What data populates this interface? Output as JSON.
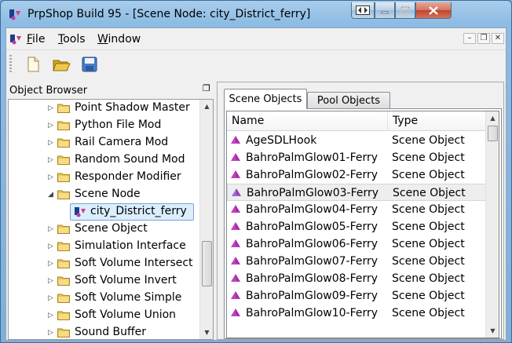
{
  "window": {
    "title": "PrpShop Build 95 - [Scene Node: city_District_ferry]",
    "restore_icon": "restore-mirror-icon",
    "min_icon": "minimize-icon",
    "max_icon": "maximize-icon",
    "close_icon": "close-icon"
  },
  "menubar": {
    "items": [
      "File",
      "Tools",
      "Window"
    ],
    "mdi_buttons": [
      "–",
      "❐",
      "✕"
    ]
  },
  "toolbar": {
    "buttons": [
      "new-file-icon",
      "open-folder-icon",
      "save-icon"
    ]
  },
  "object_browser": {
    "title": "Object Browser",
    "float_icon": "❐",
    "items": [
      {
        "label": "Point Shadow Master",
        "expanded": false
      },
      {
        "label": "Python File Mod",
        "expanded": false
      },
      {
        "label": "Rail Camera Mod",
        "expanded": false
      },
      {
        "label": "Random Sound Mod",
        "expanded": false
      },
      {
        "label": "Responder Modifier",
        "expanded": false
      },
      {
        "label": "Scene Node",
        "expanded": true
      },
      {
        "label": "city_District_ferry",
        "child": true,
        "selected": true
      },
      {
        "label": "Scene Object",
        "expanded": false
      },
      {
        "label": "Simulation Interface",
        "expanded": false
      },
      {
        "label": "Soft Volume Intersect",
        "expanded": false
      },
      {
        "label": "Soft Volume Invert",
        "expanded": false
      },
      {
        "label": "Soft Volume Simple",
        "expanded": false
      },
      {
        "label": "Soft Volume Union",
        "expanded": false
      },
      {
        "label": "Sound Buffer",
        "expanded": false
      }
    ]
  },
  "tabs": [
    "Scene Objects",
    "Pool Objects"
  ],
  "list": {
    "columns": [
      "Name",
      "Type"
    ],
    "rows": [
      {
        "name": "AgeSDLHook",
        "type": "Scene Object"
      },
      {
        "name": "BahroPalmGlow01-Ferry",
        "type": "Scene Object"
      },
      {
        "name": "BahroPalmGlow02-Ferry",
        "type": "Scene Object"
      },
      {
        "name": "BahroPalmGlow03-Ferry",
        "type": "Scene Object",
        "selected": true
      },
      {
        "name": "BahroPalmGlow04-Ferry",
        "type": "Scene Object"
      },
      {
        "name": "BahroPalmGlow05-Ferry",
        "type": "Scene Object"
      },
      {
        "name": "BahroPalmGlow06-Ferry",
        "type": "Scene Object"
      },
      {
        "name": "BahroPalmGlow07-Ferry",
        "type": "Scene Object"
      },
      {
        "name": "BahroPalmGlow08-Ferry",
        "type": "Scene Object"
      },
      {
        "name": "BahroPalmGlow09-Ferry",
        "type": "Scene Object"
      },
      {
        "name": "BahroPalmGlow10-Ferry",
        "type": "Scene Object"
      }
    ]
  },
  "colors": {
    "title_bar": "#8cbbe3",
    "selection": "#dbeefe",
    "scene_object_icon": "#c040c0"
  }
}
